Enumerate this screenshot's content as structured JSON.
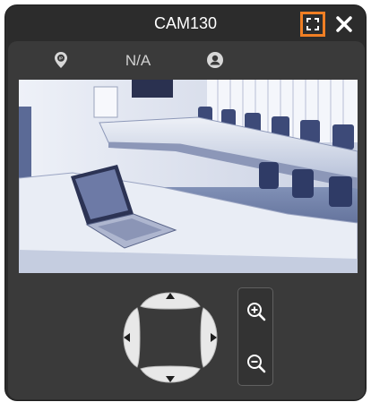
{
  "window": {
    "title": "CAM130",
    "title_icons": {
      "fullscreen": "fullscreen-icon",
      "close": "close-icon"
    },
    "accent_color": "#f07f24"
  },
  "info_bar": {
    "ip_icon": "ip-location-pin-icon",
    "status": "N/A",
    "user_icon": "user-icon"
  },
  "video": {
    "content": "conference-room-camera-feed"
  },
  "ptz": {
    "up_icon": "arrow-up-icon",
    "down_icon": "arrow-down-icon",
    "left_icon": "arrow-left-icon",
    "right_icon": "arrow-right-icon"
  },
  "zoom": {
    "in_icon": "zoom-in-icon",
    "out_icon": "zoom-out-icon"
  }
}
